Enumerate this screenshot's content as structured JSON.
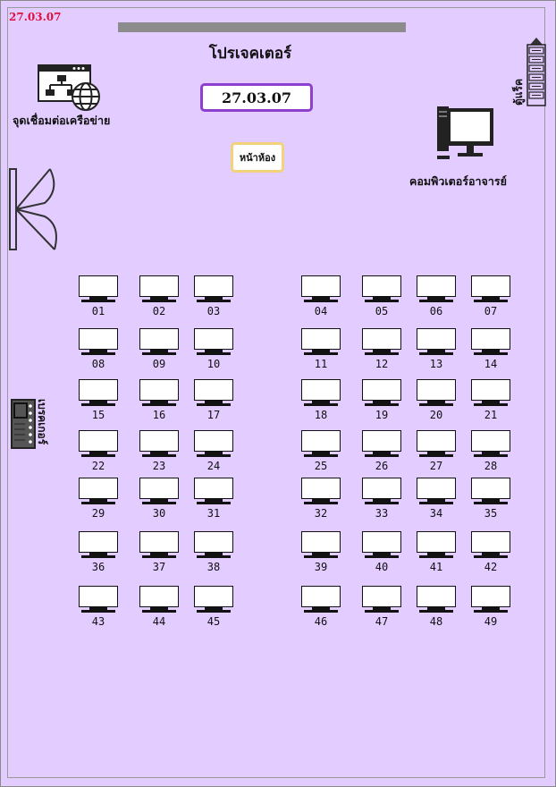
{
  "header": {
    "room_code": "27.03.07",
    "projector_label": "โปรเจคเตอร์",
    "date": "27.03.07",
    "front_label": "หน้าห้อง"
  },
  "network": {
    "label": "จุดเชื่อมต่อเครือข่าย",
    "icon": "network-globe-icon"
  },
  "rack": {
    "label": "ตู้แร็ค",
    "icon": "server-rack-icon"
  },
  "teacher": {
    "label": "คอมพิวเตอร์อาจารย์",
    "icon": "desktop-computer-icon"
  },
  "door": {
    "icon": "door-icon"
  },
  "breaker": {
    "label": "เบรคเกอร์",
    "icon": "breaker-panel-icon"
  },
  "computers": [
    "01",
    "02",
    "03",
    "04",
    "05",
    "06",
    "07",
    "08",
    "09",
    "10",
    "11",
    "12",
    "13",
    "14",
    "15",
    "16",
    "17",
    "18",
    "19",
    "20",
    "21",
    "22",
    "23",
    "24",
    "25",
    "26",
    "27",
    "28",
    "29",
    "30",
    "31",
    "32",
    "33",
    "34",
    "35",
    "36",
    "37",
    "38",
    "39",
    "40",
    "41",
    "42",
    "43",
    "44",
    "45",
    "46",
    "47",
    "48",
    "49"
  ],
  "colors": {
    "background": "#e3ccff",
    "date_border": "#8d3fd0",
    "front_border": "#f2d27a",
    "room_code": "#e0103c",
    "board": "#8c8c8c"
  }
}
